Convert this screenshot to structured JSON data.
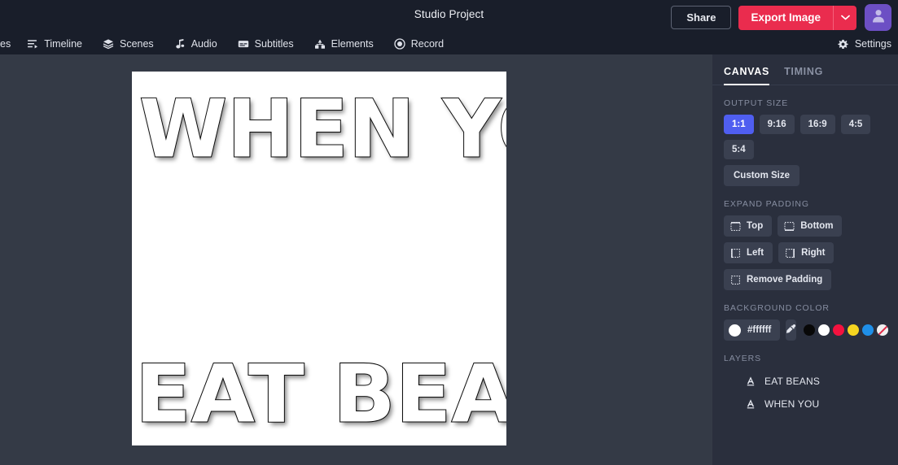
{
  "topbar": {
    "project_title": "Studio Project",
    "share_label": "Share",
    "export_label": "Export Image",
    "export_caret_icon": "chevron-down-icon",
    "avatar_icon": "user-avatar-icon",
    "accent_export": "#ea2c4e",
    "avatar_color": "#6c4fc4"
  },
  "toolbar": {
    "items": [
      {
        "label": "es",
        "icon": "clipped-nav-icon"
      },
      {
        "label": "Timeline",
        "icon": "timeline-icon"
      },
      {
        "label": "Scenes",
        "icon": "layers-stack-icon"
      },
      {
        "label": "Audio",
        "icon": "music-note-icon"
      },
      {
        "label": "Subtitles",
        "icon": "captions-icon"
      },
      {
        "label": "Elements",
        "icon": "shapes-icon"
      },
      {
        "label": "Record",
        "icon": "record-circle-icon"
      }
    ],
    "settings_label": "Settings",
    "settings_icon": "gear-icon"
  },
  "canvas": {
    "background": "#ffffff",
    "text_lines": [
      {
        "text": "WHEN YOU",
        "position": "top"
      },
      {
        "text": "EAT BEANS",
        "position": "bottom"
      }
    ]
  },
  "panel": {
    "tabs": [
      {
        "label": "CANVAS",
        "active": true
      },
      {
        "label": "TIMING",
        "active": false
      }
    ],
    "output_size": {
      "title": "OUTPUT SIZE",
      "ratios": [
        {
          "label": "1:1",
          "active": true
        },
        {
          "label": "9:16",
          "active": false
        },
        {
          "label": "16:9",
          "active": false
        },
        {
          "label": "4:5",
          "active": false
        },
        {
          "label": "5:4",
          "active": false
        }
      ],
      "custom_label": "Custom Size",
      "active_color": "#4f5ef0"
    },
    "expand_padding": {
      "title": "EXPAND PADDING",
      "buttons": [
        {
          "label": "Top",
          "icon": "padding-top-icon"
        },
        {
          "label": "Bottom",
          "icon": "padding-bottom-icon"
        },
        {
          "label": "Left",
          "icon": "padding-left-icon"
        },
        {
          "label": "Right",
          "icon": "padding-right-icon"
        },
        {
          "label": "Remove Padding",
          "icon": "padding-remove-icon"
        }
      ]
    },
    "background_color": {
      "title": "BACKGROUND COLOR",
      "hex_value": "#ffffff",
      "eyedropper_icon": "eyedropper-icon",
      "swatches": [
        {
          "name": "black",
          "color": "#080808"
        },
        {
          "name": "white",
          "color": "#ffffff"
        },
        {
          "name": "red",
          "color": "#f4123f"
        },
        {
          "name": "yellow",
          "color": "#f5d520"
        },
        {
          "name": "blue",
          "color": "#1f8fe8"
        },
        {
          "name": "none",
          "color": "transparent"
        }
      ]
    },
    "layers": {
      "title": "LAYERS",
      "items": [
        {
          "name": "EAT BEANS",
          "icon": "text-layer-icon"
        },
        {
          "name": "WHEN YOU",
          "icon": "text-layer-icon"
        }
      ]
    }
  }
}
